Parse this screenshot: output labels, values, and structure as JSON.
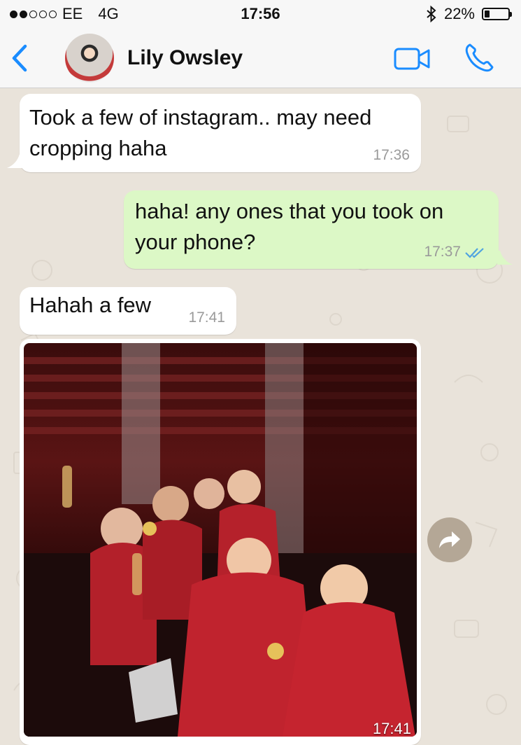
{
  "status_bar": {
    "carrier": "EE",
    "network": "4G",
    "time": "17:56",
    "battery": "22%",
    "battery_level": 0.22,
    "signal_bars_filled": 2,
    "signal_bars_total": 5
  },
  "header": {
    "contact_name": "Lily Owsley",
    "icons": [
      "back-chevron-icon",
      "video-call-icon",
      "phone-icon"
    ]
  },
  "messages": [
    {
      "direction": "incoming",
      "text_lines": [
        "Took a few of instagram.. may need",
        "cropping haha"
      ],
      "time": "17:36"
    },
    {
      "direction": "outgoing",
      "text_lines": [
        "haha! any ones that you took on",
        "your phone?"
      ],
      "time": "17:37",
      "status": "read"
    },
    {
      "direction": "incoming",
      "text_lines": [
        "Hahah a few"
      ],
      "time": "17:41"
    },
    {
      "direction": "incoming",
      "type": "photo",
      "time": "17:41"
    }
  ],
  "colors": {
    "accent": "#1a8cff",
    "incoming_bubble": "#ffffff",
    "outgoing_bubble": "#dcf8c6",
    "read_ticks": "#4fa3e0",
    "chat_background": "#e9e3da",
    "forward_button": "#b4a796"
  }
}
